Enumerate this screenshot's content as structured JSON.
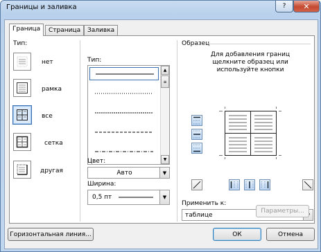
{
  "window": {
    "title": "Границы и заливка",
    "help_label": "?",
    "close_label": "✕"
  },
  "tabs": [
    {
      "label": "Граница",
      "active": true
    },
    {
      "label": "Страница",
      "active": false
    },
    {
      "label": "Заливка",
      "active": false
    }
  ],
  "type_section": {
    "label": "Тип:",
    "items": [
      {
        "label": "нет"
      },
      {
        "label": "рамка"
      },
      {
        "label": "все",
        "selected": true
      },
      {
        "label": "сетка"
      },
      {
        "label": "другая"
      }
    ]
  },
  "style_section": {
    "label": "Тип:",
    "styles": [
      "solid",
      "dotted",
      "dash-short",
      "dash",
      "dash-dot"
    ],
    "selected_index": 0
  },
  "color": {
    "label": "Цвет:",
    "value": "Авто"
  },
  "width": {
    "label": "Ширина:",
    "value": "0,5 пт"
  },
  "preview": {
    "label": "Образец",
    "hint": "Для добавления границ щелкните образец или используйте кнопки"
  },
  "apply": {
    "label": "Применить к:",
    "value": "таблице"
  },
  "buttons": {
    "params": "Параметры...",
    "horizontal_line": "Горизонтальная линия...",
    "ok": "ОК",
    "cancel": "Отмена"
  },
  "colors": {
    "accent": "#3a6fb0",
    "title_bar": "#c0d6ee",
    "close": "#c4492f"
  }
}
